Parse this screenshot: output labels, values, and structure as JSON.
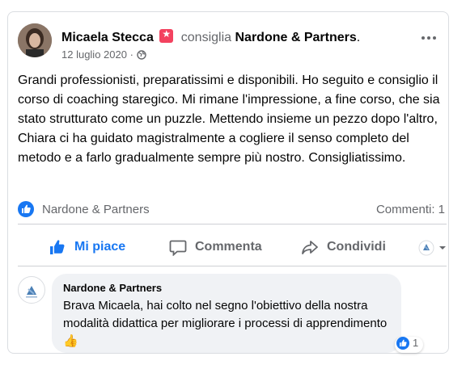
{
  "post": {
    "author": "Micaela Stecca",
    "recommends_text": "consiglia",
    "page_name": "Nardone & Partners",
    "page_name_suffix": ".",
    "date": "12 luglio 2020",
    "date_separator": "·",
    "privacy_icon": "globe-icon",
    "more_icon": "more-options-icon",
    "body": "Grandi professionisti, preparatissimi e disponibili. Ho seguito e consiglio il corso di coaching staregico. Mi rimane l'impressione, a fine corso, che sia stato strutturato come un puzzle. Mettendo insieme un pezzo dopo l'altro, Chiara ci ha guidato magistralmente a cogliere il senso completo del metodo e a farlo gradualmente sempre più nostro. Consigliatissimo."
  },
  "reactions": {
    "reactor": "Nardone & Partners",
    "comments_count": "Commenti: 1"
  },
  "actions": {
    "like": "Mi piace",
    "comment": "Commenta",
    "share": "Condividi"
  },
  "comment": {
    "author": "Nardone & Partners",
    "text": "Brava Micaela, hai colto nel segno l'obiettivo della nostra modalità didattica per migliorare i processi di apprendimento 👍",
    "like_count": "1"
  },
  "colors": {
    "accent": "#1877f2",
    "recommend_badge": "#f3425f",
    "muted_text": "#65676b"
  }
}
